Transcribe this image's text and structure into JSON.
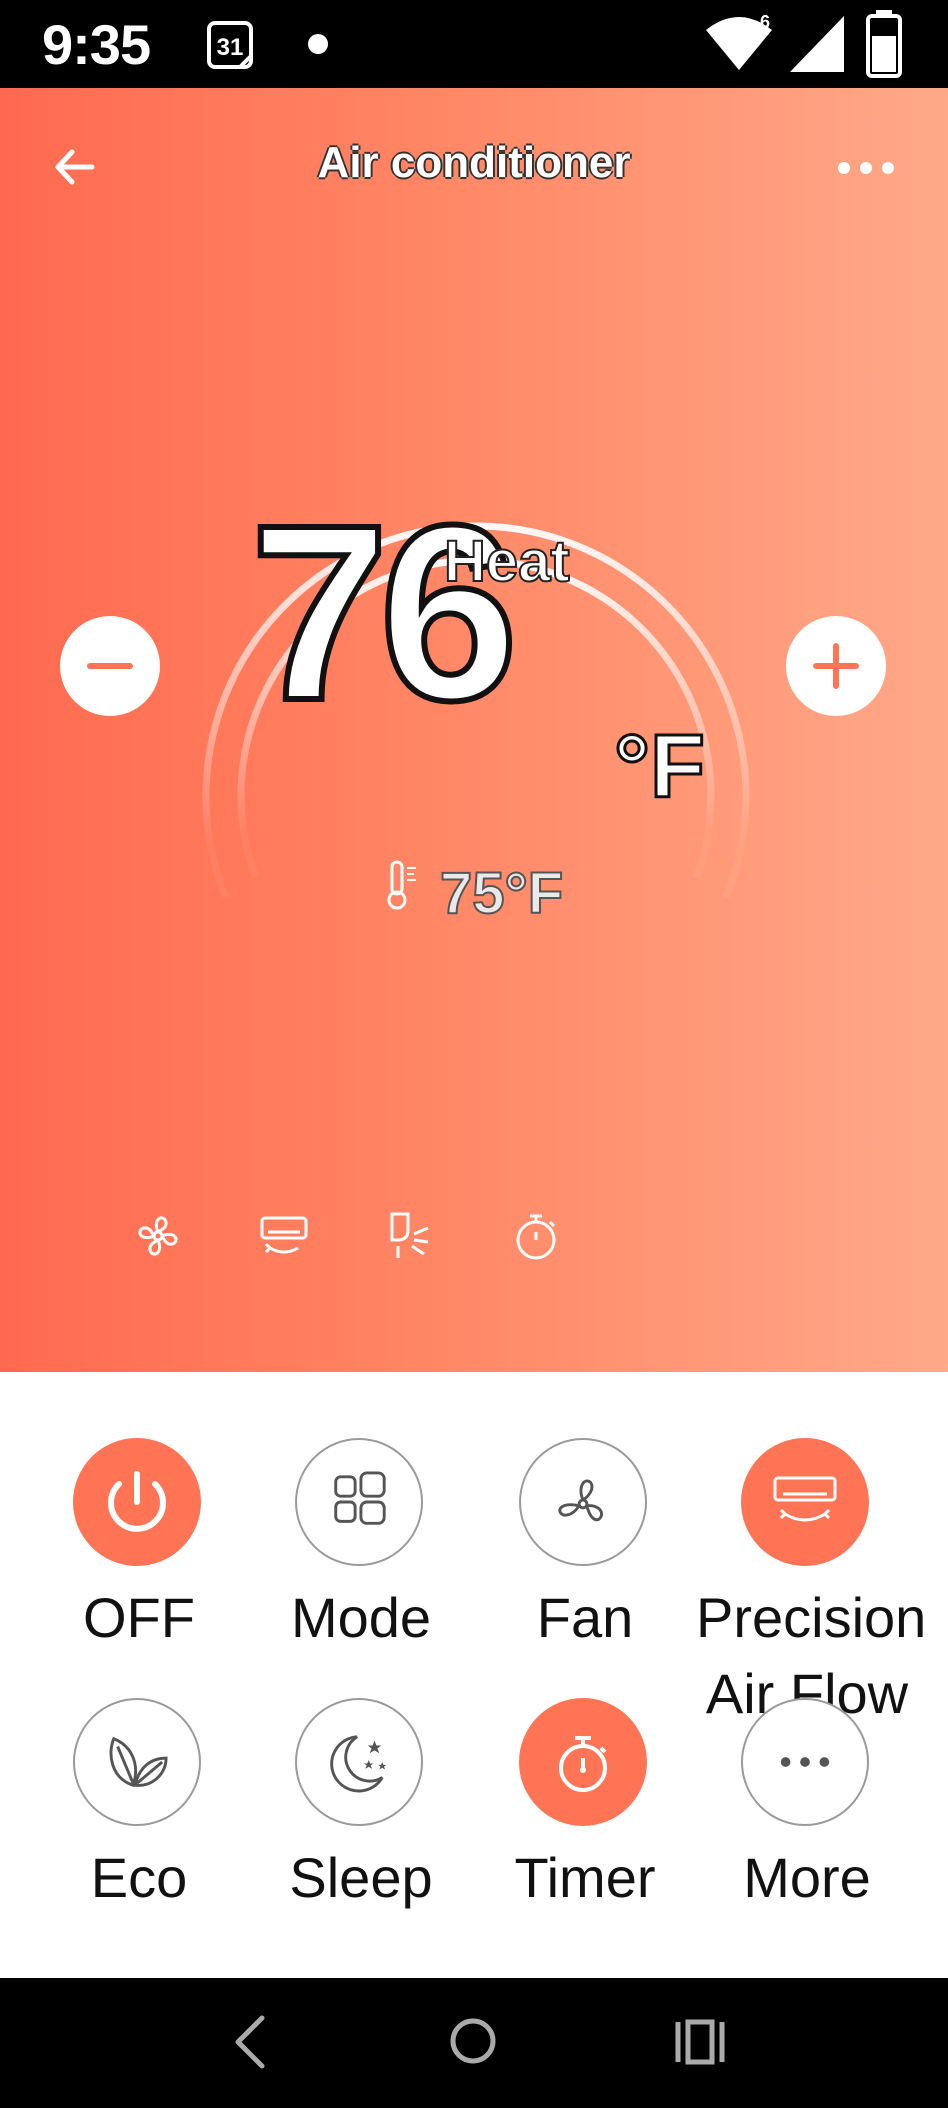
{
  "status_bar": {
    "time": "9:35",
    "calendar_day": "31",
    "network_badge": "6"
  },
  "header": {
    "title": "Air conditioner"
  },
  "thermostat": {
    "set_temperature": "76",
    "unit": "°F",
    "mode": "Heat",
    "room_temperature": "75°F"
  },
  "status_icons": [
    "fan-icon",
    "air-unit-icon",
    "swing-icon",
    "timer-icon"
  ],
  "controls": [
    {
      "label": "OFF",
      "icon": "power-icon",
      "active": true
    },
    {
      "label": "Mode",
      "icon": "grid-icon",
      "active": false
    },
    {
      "label": "Fan",
      "icon": "fan-icon",
      "active": false
    },
    {
      "label": "Precision Air Flow",
      "icon": "air-flow-icon",
      "active": true
    },
    {
      "label": "Eco",
      "icon": "leaf-icon",
      "active": false
    },
    {
      "label": "Sleep",
      "icon": "moon-icon",
      "active": false
    },
    {
      "label": "Timer",
      "icon": "timer-icon",
      "active": true
    },
    {
      "label": "More",
      "icon": "more-dots-icon",
      "active": false
    }
  ],
  "colors": {
    "accent": "#ff7455",
    "gradient_start": "#ff6a4f",
    "gradient_end": "#ffa988"
  }
}
